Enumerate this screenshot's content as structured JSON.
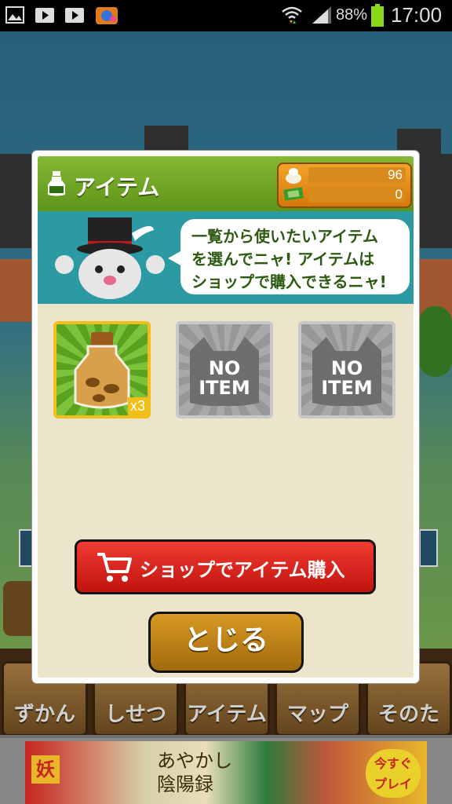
{
  "status_bar": {
    "battery": "88%",
    "time": "17:00",
    "icons": [
      "gallery-icon",
      "play-store-icon",
      "play-movies-icon",
      "camera-app-icon",
      "wifi-icon",
      "signal-icon",
      "battery-icon"
    ]
  },
  "game_nav": {
    "items": [
      {
        "label": "ずかん"
      },
      {
        "label": "しせつ"
      },
      {
        "label": "アイテム"
      },
      {
        "label": "マップ"
      },
      {
        "label": "そのた"
      }
    ]
  },
  "ad": {
    "label1": "妖",
    "title": "あやかし\n陰陽録",
    "label2": "今すぐ\nプレイ"
  },
  "modal": {
    "title": "アイテム",
    "currency": {
      "coins": "96",
      "tickets": "0"
    },
    "message": "一覧から使いたいアイテム\nを選んでニャ! アイテムは\nショップで購入できるニャ!",
    "slots": [
      {
        "type": "item",
        "quantity": "x3",
        "icon": "potion-bottle-icon"
      },
      {
        "type": "empty",
        "label": "NO\nITEM"
      },
      {
        "type": "empty",
        "label": "NO\nITEM"
      }
    ],
    "shop_button": "ショップでアイテム購入",
    "close_button": "とじる"
  },
  "colors": {
    "header_green": "#6fa424",
    "info_teal": "#2c9aa3",
    "panel_cream": "#ede5cb",
    "shop_red": "#d9231c",
    "close_gold": "#c18418",
    "slot_gold": "#f2be1a"
  }
}
